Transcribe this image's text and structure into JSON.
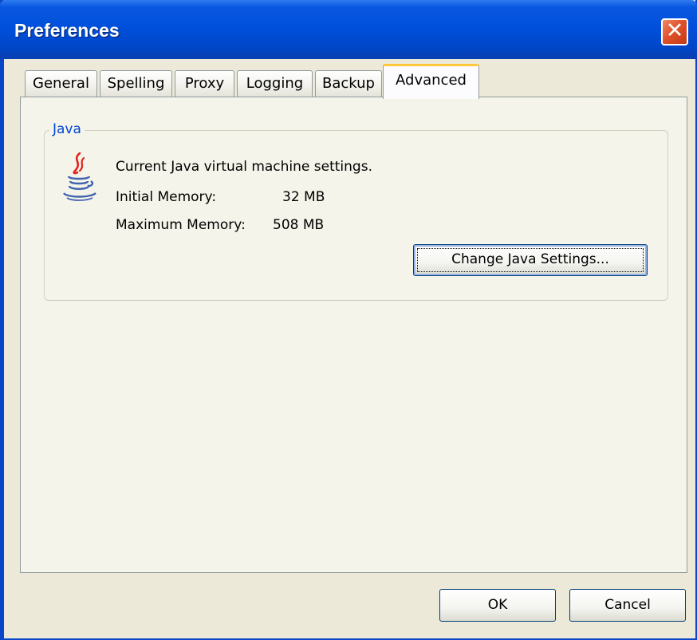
{
  "window": {
    "title": "Preferences",
    "close_glyph": "✕"
  },
  "tabs": [
    {
      "label": "General"
    },
    {
      "label": "Spelling"
    },
    {
      "label": "Proxy"
    },
    {
      "label": "Logging"
    },
    {
      "label": "Backup"
    },
    {
      "label": "Advanced",
      "active": true
    }
  ],
  "java_group": {
    "legend": "Java",
    "icon": "java-cup-icon",
    "description": "Current Java virtual machine settings.",
    "initial_memory_label": "Initial Memory:",
    "initial_memory_value": "32  MB",
    "maximum_memory_label": "Maximum Memory:",
    "maximum_memory_value": "508  MB",
    "change_button_label": "Change Java Settings..."
  },
  "buttons": {
    "ok": "OK",
    "cancel": "Cancel"
  },
  "colors": {
    "titlebar": "#0050dc",
    "window_face": "#ece9d8",
    "legend_text": "#0046d5",
    "active_tab_highlight": "#ffc83c",
    "close_button": "#e0512a"
  }
}
